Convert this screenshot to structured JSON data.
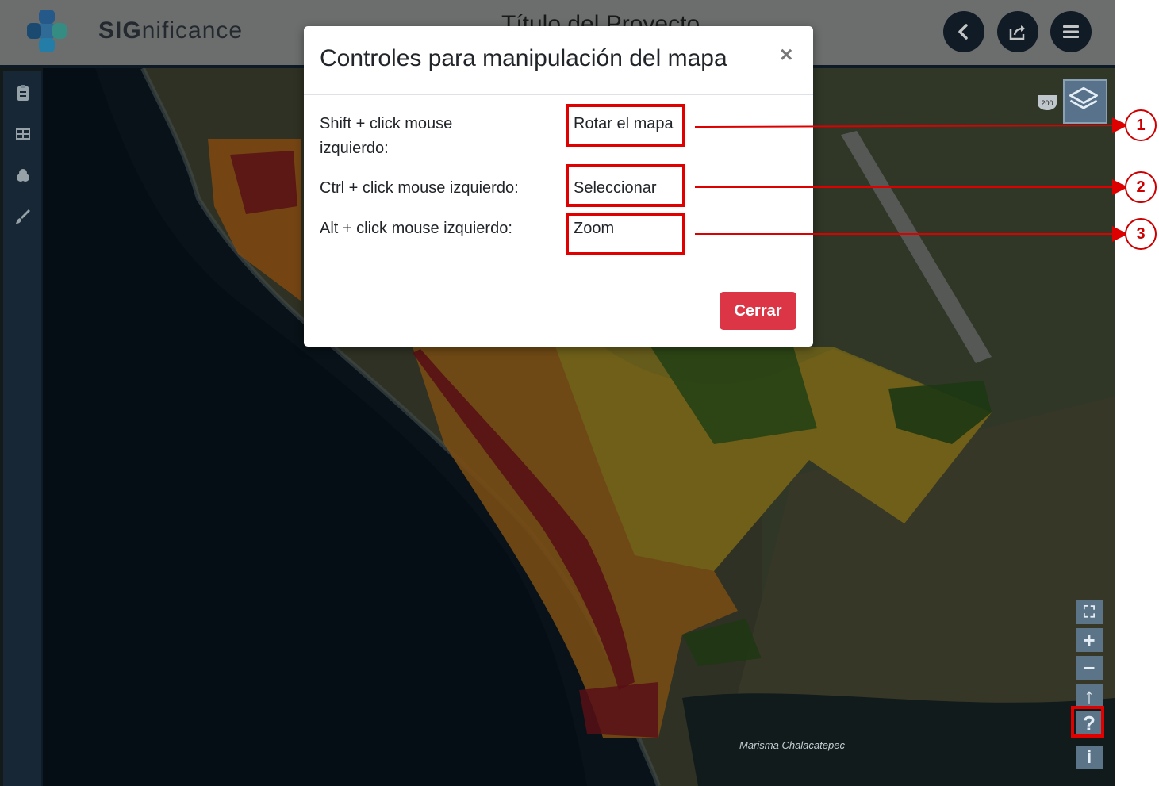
{
  "header": {
    "logo_text_bold": "SIG",
    "logo_text_rest": "nificance",
    "project_title": "Título del Proyecto",
    "buttons": [
      {
        "icon": "chevron-left-icon"
      },
      {
        "icon": "share-icon"
      },
      {
        "icon": "hamburger-menu-icon"
      }
    ]
  },
  "sidebar": {
    "tools": [
      "clipboard-icon",
      "table-icon",
      "layers-stack-icon",
      "brush-icon"
    ]
  },
  "map": {
    "place_label": "Marisma Chalacatepec",
    "road_shield": "200",
    "controls": [
      {
        "name": "fullscreen-icon",
        "glyph": "⛶"
      },
      {
        "name": "zoom-in-icon",
        "glyph": "+"
      },
      {
        "name": "zoom-out-icon",
        "glyph": "−"
      },
      {
        "name": "north-arrow-icon",
        "glyph": "↑"
      },
      {
        "name": "help-icon",
        "glyph": "?"
      },
      {
        "name": "info-icon",
        "glyph": "i"
      }
    ]
  },
  "modal": {
    "title": "Controles para manipulación del mapa",
    "close_glyph": "×",
    "rows": [
      {
        "label_line1": "Shift + click mouse",
        "label_line2": "izquierdo:",
        "value": "Rotar el mapa"
      },
      {
        "label": "Ctrl + click mouse izquierdo:",
        "value": "Seleccionar"
      },
      {
        "label": "Alt + click mouse izquierdo:",
        "value": "Zoom"
      }
    ],
    "close_button": "Cerrar"
  },
  "callouts": [
    "1",
    "2",
    "3"
  ],
  "colors": {
    "highlight": "#e00000",
    "button_danger": "#dc3545",
    "header_dark": "#0f1c2b"
  }
}
